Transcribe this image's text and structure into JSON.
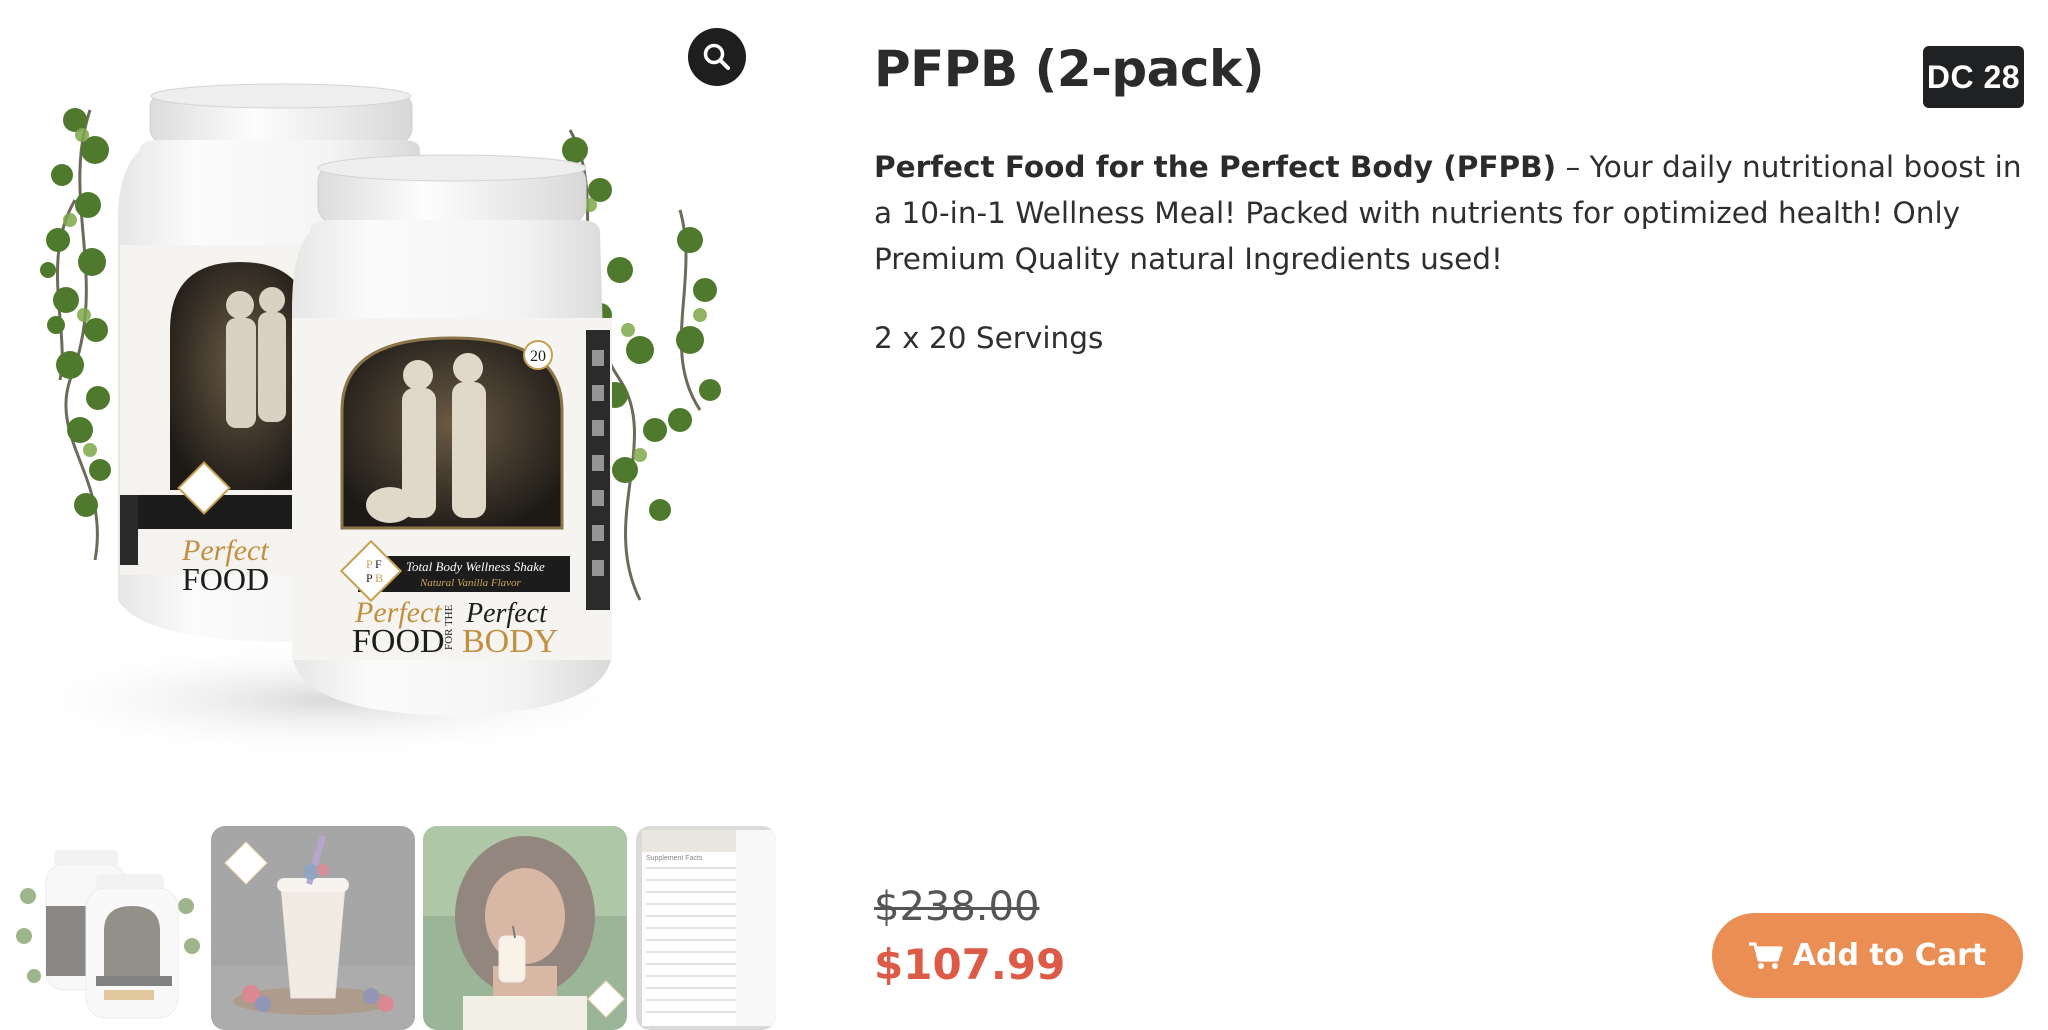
{
  "product": {
    "title": "PFPB (2-pack)",
    "badge": "DC 28",
    "description_bold": "Perfect Food for the Perfect Body (PFPB)",
    "description_rest": " – Your daily nutritional boost in a 10-in-1 Wellness Meal! Packed with nutrients for optimized health! Only Premium Quality natural Ingredients used!",
    "servings": "2 x 20 Servings"
  },
  "pricing": {
    "regular_price": "$238.00",
    "sale_price": "$107.99"
  },
  "cart": {
    "label": "Add to Cart",
    "icon": "cart-icon"
  },
  "gallery": {
    "zoom_icon": "magnifier-icon",
    "jar_label": {
      "logo_letters": [
        "P",
        "F",
        "P",
        "B"
      ],
      "servings_count": "20",
      "product_line": "Total Body Wellness Shake",
      "flavor": "Natural Vanilla Flavor",
      "word_perfect": "Perfect",
      "word_food": "FOOD",
      "word_for_the": "FOR THE",
      "word_perfect2": "Perfect",
      "word_body": "BODY"
    },
    "thumbnails": [
      "jars-2-pack",
      "berry-smoothie",
      "woman-with-shake",
      "supplement-facts"
    ],
    "supplement_facts_heading": "Supplement Facts"
  },
  "colors": {
    "accent_button": "#eb8e53",
    "sale_price": "#dd5a47",
    "badge_bg": "#1f2123",
    "zoom_bg": "#1e1e1e"
  }
}
